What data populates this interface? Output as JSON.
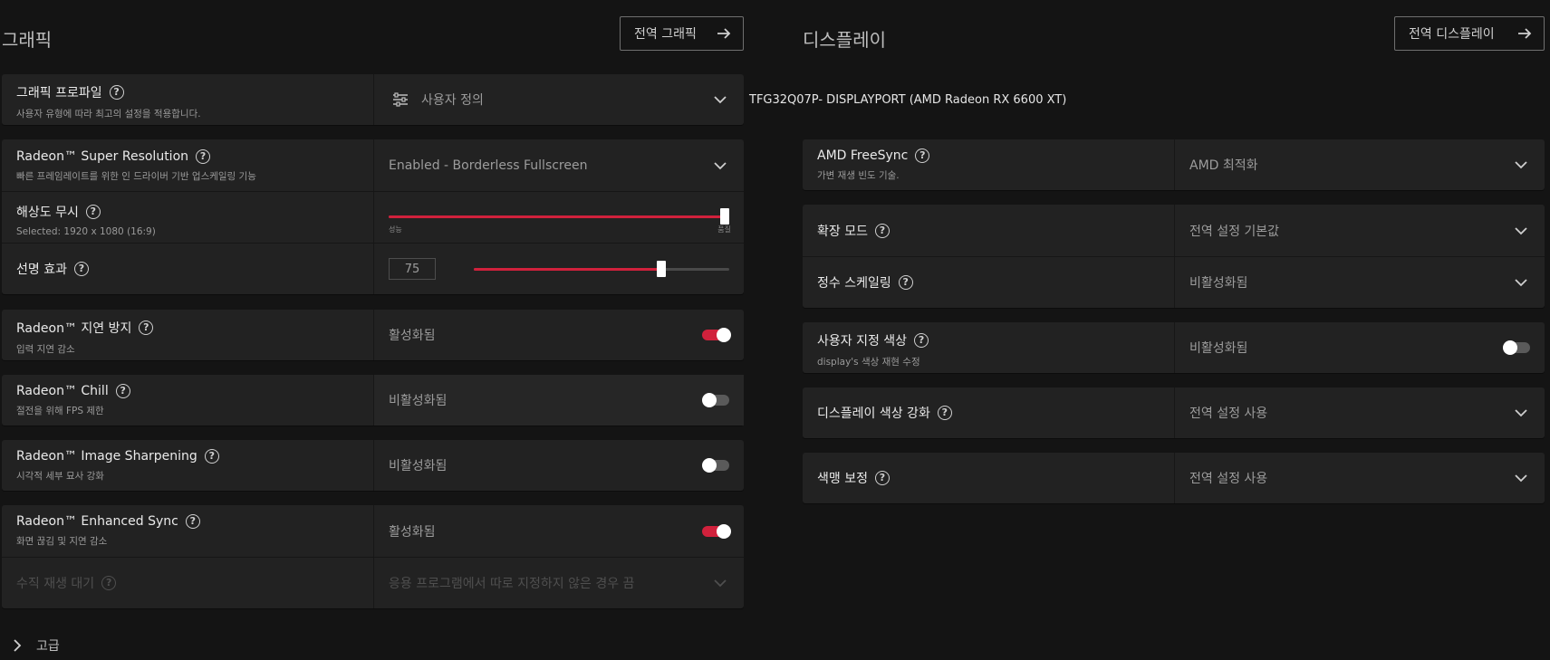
{
  "graphics": {
    "title": "그래픽",
    "global_button": "전역 그래픽",
    "profile": {
      "label": "그래픽 프로파일",
      "sub": "사용자 유형에 따라 최고의 설정을 적용합니다.",
      "value": "사용자 정의",
      "icon": "sliders-icon"
    },
    "rsr": {
      "label": "Radeon™ Super Resolution",
      "sub": "빠른 프레임레이트를 위한 인 드라이버 기반 업스케일링 기능",
      "value": "Enabled - Borderless Fullscreen"
    },
    "res_override": {
      "label": "해상도 무시",
      "sub": "Selected: 1920 x 1080 (16:9)",
      "min_label": "성능",
      "max_label": "품질",
      "level": 1.0
    },
    "sharpness": {
      "label": "선명 효과",
      "value": "75",
      "level": 0.75
    },
    "anti_lag": {
      "label": "Radeon™ 지연 방지",
      "sub": "입력 지연 감소",
      "value": "활성화됨",
      "on": true
    },
    "chill": {
      "label": "Radeon™ Chill",
      "sub": "절전을 위해 FPS 제한",
      "value": "비활성화됨",
      "on": false
    },
    "image_sharpening": {
      "label": "Radeon™ Image Sharpening",
      "sub": "시각적 세부 묘사 강화",
      "value": "비활성화됨",
      "on": false
    },
    "enhanced_sync": {
      "label": "Radeon™ Enhanced Sync",
      "sub": "화면 끊김 및 지연 감소",
      "value": "활성화됨",
      "on": true
    },
    "vsync": {
      "label": "수직 재생 대기",
      "value": "응용 프로그램에서 따로 지정하지 않은 경우 끔"
    },
    "advanced": "고급"
  },
  "display": {
    "title": "디스플레이",
    "global_button": "전역 디스플레이",
    "device": "TFG32Q07P- DISPLAYPORT (AMD Radeon RX 6600 XT)",
    "freesync": {
      "label": "AMD FreeSync",
      "sub": "가변 재생 빈도 기술.",
      "value": "AMD 최적화"
    },
    "expand_mode": {
      "label": "확장 모드",
      "value": "전역 설정 기본값"
    },
    "integer_scaling": {
      "label": "정수 스케일링",
      "value": "비활성화됨"
    },
    "custom_color": {
      "label": "사용자 지정 색상",
      "sub": "display's 색상 재현 수정",
      "value": "비활성화됨",
      "on": false
    },
    "color_enhance": {
      "label": "디스플레이 색상 강화",
      "value": "전역 설정 사용"
    },
    "color_correction": {
      "label": "색맹 보정",
      "value": "전역 설정 사용"
    }
  },
  "colors": {
    "accent": "#d1213c",
    "card": "#222222",
    "background": "#141414"
  }
}
